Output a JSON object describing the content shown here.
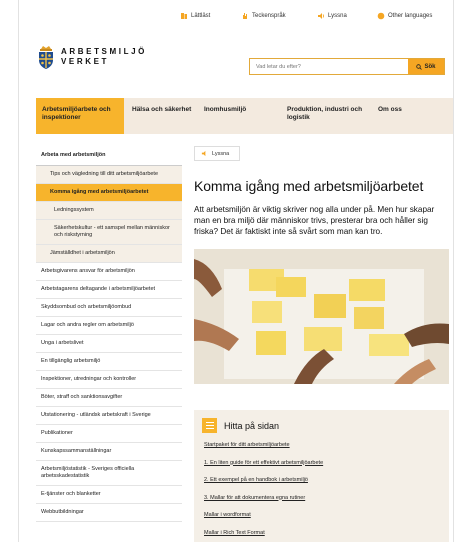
{
  "utility": {
    "easy_read": "Lättläst",
    "sign_language": "Teckenspråk",
    "listen": "Lyssna",
    "other_languages": "Other languages"
  },
  "logo": {
    "line1": "ARBETSMILJÖ",
    "line2": "VERKET"
  },
  "search": {
    "placeholder": "Vad letar du efter?",
    "button": "Sök"
  },
  "nav": [
    {
      "label": "Arbetsmiljöarbete och inspektioner"
    },
    {
      "label": "Hälsa och säkerhet"
    },
    {
      "label": "Inomhusmiljö"
    },
    {
      "label": "Produktion, industri och logistik"
    },
    {
      "label": "Om oss"
    }
  ],
  "sidebar": {
    "heading": "Arbeta med arbetsmiljön",
    "items": [
      "Tips och vägledning till ditt arbetsmiljöarbete",
      "Komma igång med arbetsmiljöarbetet",
      "Ledningssystem",
      "Säkerhetskultur - ett samspel mellan människor och riskstyrning",
      "Jämställdhet i arbetsmiljön",
      "Arbetsgivarens ansvar för arbetsmiljön",
      "Arbetstagarens deltagande i arbetsmiljöarbetet",
      "Skyddsombud och arbetsmiljöombud",
      "Lagar och andra regler om arbetsmiljö",
      "Unga i arbetslivet",
      "En tillgänglig arbetsmiljö",
      "Inspektioner, utredningar och kontroller",
      "Böter, straff och sanktionsavgifter",
      "Utstationering - utländsk arbetskraft i Sverige",
      "Publikationer",
      "Kunskapssammanställningar",
      "Arbetsmiljöstatistik - Sveriges officiella arbetsskadestatistik",
      "E-tjänster och blanketter",
      "Webbutbildningar"
    ]
  },
  "content": {
    "listen_label": "Lyssna",
    "title": "Komma igång med arbetsmiljöarbetet",
    "lead": "Att arbetsmiljön är viktig skriver nog alla under på. Men hur skapar man en bra miljö där människor trivs, presterar bra och håller sig friska? Det är faktiskt inte så svårt som man kan tro."
  },
  "find": {
    "title": "Hitta på sidan",
    "links": [
      "Startpaket för ditt arbetsmiljöarbete",
      "1. En liten guide för ett effektivt arbetsmiljöarbete",
      "2. Ett exempel på en handbok i arbetsmiljö",
      "3. Mallar för att dokumentera egna rutiner",
      "Mallar i wordformat",
      "Mallar i Rich Text Format"
    ]
  },
  "colors": {
    "accent": "#f7b42c",
    "nav_bg": "#f3eadf",
    "sidebar_sub_bg": "#f5efe6"
  }
}
